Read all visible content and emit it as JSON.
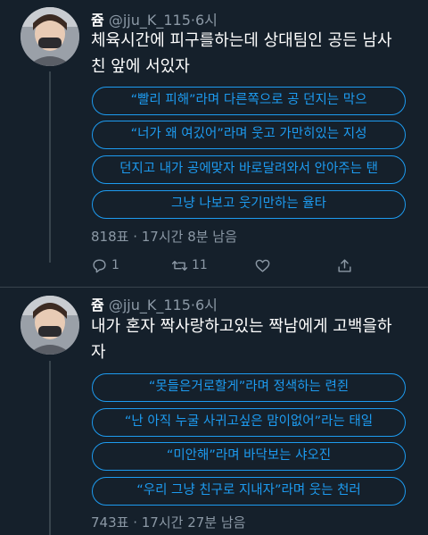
{
  "tweets": [
    {
      "author": "쥼",
      "handle": "@jju_K_115",
      "separator": "·",
      "time": "6시",
      "text_lines": [
        "체육시간에 피구를하는데 상대팀인 공든 남사",
        "친 앞에 서있자"
      ],
      "options": [
        "“빨리 피해”라며 다른쪽으로 공 던지는 막으",
        "“너가 왜 여깄어”라며 웃고 가만히있는 지성",
        "던지고 내가 공에맞자 바로달려와서 안아주는 탠",
        "그냥 나보고 웃기만하는 율타"
      ],
      "poll_meta": "818표 · 17시간 8분 남음",
      "actions": {
        "reply_count": "1",
        "retweet_count": "11"
      }
    },
    {
      "author": "쥼",
      "handle": "@jju_K_115",
      "separator": "·",
      "time": "6시",
      "text_lines": [
        "내가 혼자 짝사랑하고있는 짝남에게 고백을하",
        "자"
      ],
      "options": [
        "“못들은거로할게”라며 정색하는 련쥔",
        "“난 아직 누굴 사귀고싶은 맘이없어”라는 태일",
        "“미안해”라며 바닥보는 샤오진",
        "“우리 그냥 친구로 지내자”라며 웃는 천러"
      ],
      "poll_meta": "743표 · 17시간 27분 남음"
    }
  ],
  "colors": {
    "background": "#15202b",
    "accent": "#1d9bf0",
    "secondary_text": "#8b98a5",
    "thread_line": "#38444d"
  },
  "icons": {
    "reply": "reply-icon",
    "retweet": "retweet-icon",
    "like": "heart-icon",
    "share": "share-icon"
  }
}
